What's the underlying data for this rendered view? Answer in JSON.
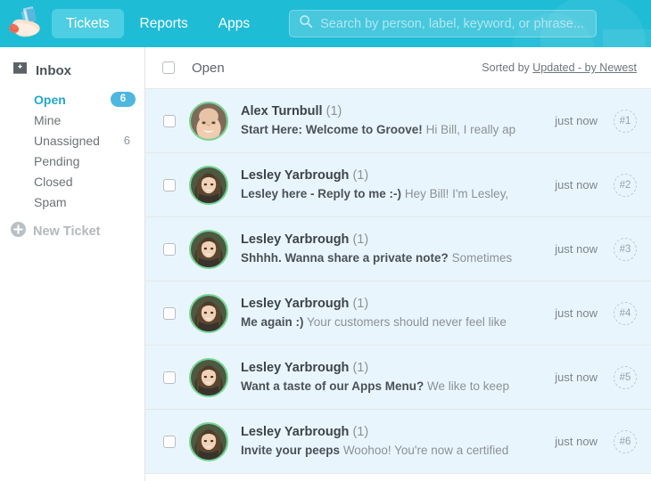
{
  "header": {
    "logo_icon": "groove-hand-envelope-logo",
    "nav": [
      {
        "label": "Tickets",
        "active": true
      },
      {
        "label": "Reports",
        "active": false
      },
      {
        "label": "Apps",
        "active": false
      }
    ],
    "search": {
      "icon": "search-icon",
      "placeholder": "Search by person, label, keyword, or phrase...",
      "value": ""
    },
    "accent_color": "#1fbcd6",
    "active_tab_color": "#4ecee2"
  },
  "sidebar": {
    "inbox": {
      "icon": "inbox-icon",
      "label": "Inbox"
    },
    "folders": [
      {
        "label": "Open",
        "count": "6",
        "count_style": "pill",
        "active": true
      },
      {
        "label": "Mine",
        "count": "",
        "count_style": "none",
        "active": false
      },
      {
        "label": "Unassigned",
        "count": "6",
        "count_style": "plain",
        "active": false
      },
      {
        "label": "Pending",
        "count": "",
        "count_style": "none",
        "active": false
      },
      {
        "label": "Closed",
        "count": "",
        "count_style": "none",
        "active": false
      },
      {
        "label": "Spam",
        "count": "",
        "count_style": "none",
        "active": false
      }
    ],
    "new_ticket": {
      "icon": "plus-circle-icon",
      "label": "New Ticket"
    },
    "badge_color": "#4db7e0",
    "active_color": "#22a7d0"
  },
  "list_header": {
    "select_all_checked": false,
    "title": "Open",
    "sorted_prefix": "Sorted by ",
    "sorted_value": "Updated - by Newest"
  },
  "tickets": [
    {
      "sender": "Alex Turnbull",
      "count": "(1)",
      "subject": "Start Here: Welcome to Groove!",
      "preview": "Hi Bill, I really ap",
      "time": "just now",
      "number": "#1",
      "avatar": "male-portrait",
      "unread": true
    },
    {
      "sender": "Lesley Yarbrough",
      "count": "(1)",
      "subject": "Lesley here - Reply to me :-)",
      "preview": "Hey Bill! I'm Lesley,",
      "time": "just now",
      "number": "#2",
      "avatar": "female-portrait",
      "unread": true
    },
    {
      "sender": "Lesley Yarbrough",
      "count": "(1)",
      "subject": "Shhhh. Wanna share a private note?",
      "preview": "Sometimes",
      "time": "just now",
      "number": "#3",
      "avatar": "female-portrait",
      "unread": true
    },
    {
      "sender": "Lesley Yarbrough",
      "count": "(1)",
      "subject": "Me again :)",
      "preview": "Your customers should never feel like",
      "time": "just now",
      "number": "#4",
      "avatar": "female-portrait",
      "unread": true
    },
    {
      "sender": "Lesley Yarbrough",
      "count": "(1)",
      "subject": "Want a taste of our Apps Menu?",
      "preview": "We like to keep",
      "time": "just now",
      "number": "#5",
      "avatar": "female-portrait",
      "unread": true
    },
    {
      "sender": "Lesley Yarbrough",
      "count": "(1)",
      "subject": "Invite your peeps",
      "preview": "Woohoo! You're now a certified",
      "time": "just now",
      "number": "#6",
      "avatar": "female-portrait",
      "unread": true
    }
  ]
}
